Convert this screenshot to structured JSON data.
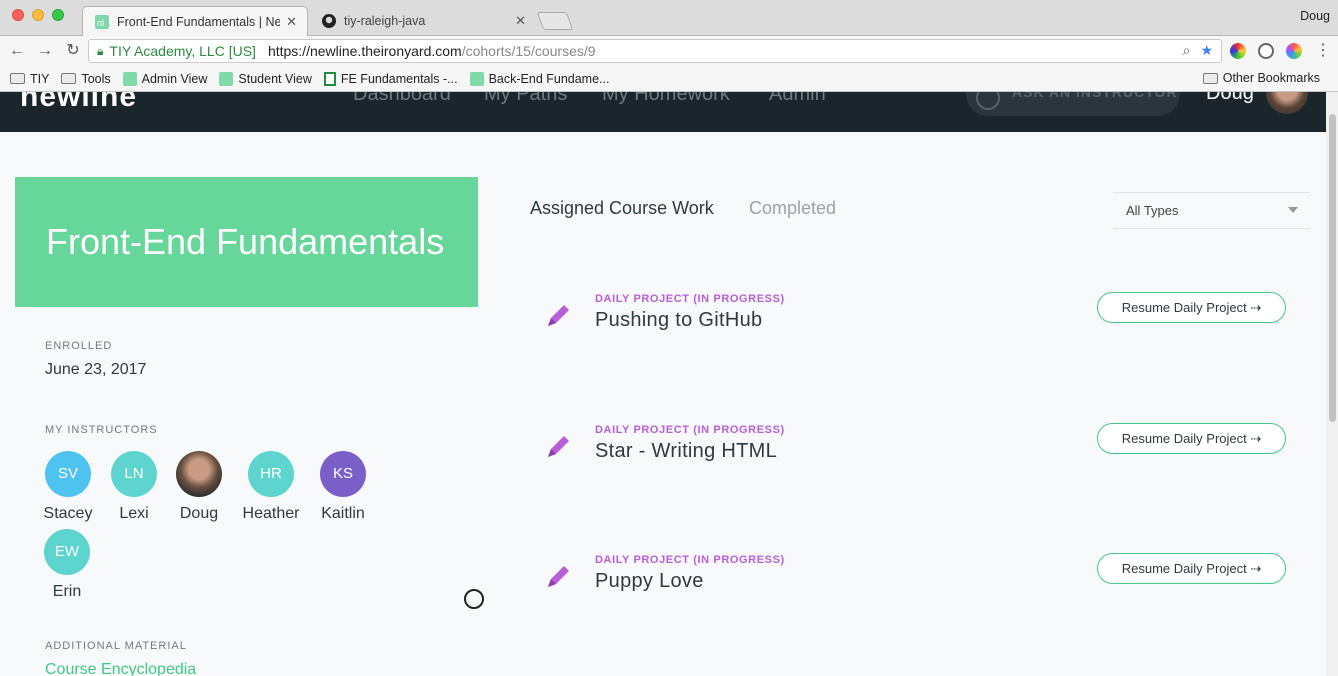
{
  "browser": {
    "tabs": [
      {
        "title": "Front-End Fundamentals | New",
        "close": "✕"
      },
      {
        "title": "tiy-raleigh-java",
        "close": "✕"
      }
    ],
    "profile_name": "Doug",
    "org": "TIY Academy, LLC [US]",
    "url_base": "https://newline.theironyard.com",
    "url_path": "/cohorts/15/courses/9",
    "bookmarks": [
      "TIY",
      "Tools",
      "Admin View",
      "Student View",
      "FE Fundamentals -...",
      "Back-End Fundame..."
    ],
    "other_bookmarks": "Other Bookmarks"
  },
  "header": {
    "logo": "newline",
    "nav": [
      "Dashboard",
      "My Paths",
      "My Homework",
      "Admin"
    ],
    "ask_label": "ASK AN INSTRUCTOR",
    "user_name": "Doug"
  },
  "course": {
    "title": "Front-End Fundamentals",
    "enrolled_label": "ENROLLED",
    "enrolled_date": "June 23, 2017",
    "instructors_label": "MY INSTRUCTORS",
    "instructors": [
      {
        "initials": "SV",
        "name": "Stacey",
        "color": "#4fc3f0"
      },
      {
        "initials": "LN",
        "name": "Lexi",
        "color": "#5ed4cf"
      },
      {
        "initials": "",
        "name": "Doug",
        "color": "#6a5040"
      },
      {
        "initials": "HR",
        "name": "Heather",
        "color": "#5ed4cf"
      },
      {
        "initials": "KS",
        "name": "Kaitlin",
        "color": "#7b5fc9"
      },
      {
        "initials": "EW",
        "name": "Erin",
        "color": "#5ed4cf"
      }
    ],
    "additional_label": "ADDITIONAL MATERIAL",
    "additional_link": "Course Encyclopedia"
  },
  "coursework": {
    "tab_assigned": "Assigned Course Work",
    "tab_completed": "Completed",
    "filter_value": "All Types",
    "projects": [
      {
        "type": "DAILY PROJECT (IN PROGRESS)",
        "title": "Pushing to GitHub",
        "button": "Resume Daily Project ⇢"
      },
      {
        "type": "DAILY PROJECT (IN PROGRESS)",
        "title": "Star - Writing HTML",
        "button": "Resume Daily Project ⇢"
      },
      {
        "type": "DAILY PROJECT (IN PROGRESS)",
        "title": "Puppy Love",
        "button": "Resume Daily Project ⇢"
      }
    ]
  },
  "colors": {
    "accent": "#66d69b",
    "project_type": "#b85fd6",
    "header_bg": "#1b252c"
  }
}
